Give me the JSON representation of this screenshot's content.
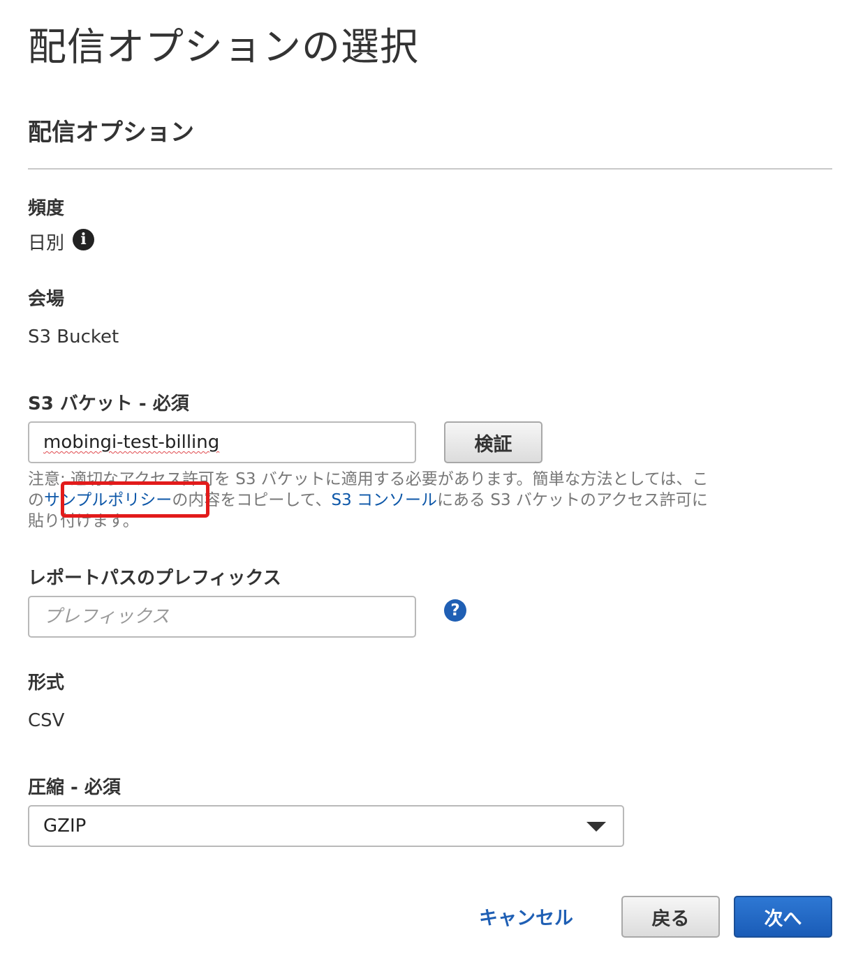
{
  "page": {
    "title": "配信オプションの選択",
    "section_title": "配信オプション"
  },
  "frequency": {
    "label": "頻度",
    "value": "日別",
    "info_icon_glyph": "i"
  },
  "destination": {
    "label": "会場",
    "value": "S3 Bucket"
  },
  "s3_bucket": {
    "label": "S3 バケット - 必須",
    "value": "mobingi-test-billing",
    "verify_button": "検証"
  },
  "note": {
    "prefix": "注意: 適切なアクセス許可を S3 バケットに適用する必要があります。簡単な方法としては、この",
    "sample_policy_link": "サンプルポリシー",
    "middle": "の内容をコピーして、",
    "console_link": "S3 コンソール",
    "suffix": "にある S3 バケットのアクセス許可に貼り付けます。",
    "highlight_color": "#e21b1b"
  },
  "report_prefix": {
    "label": "レポートパスのプレフィックス",
    "placeholder": "プレフィックス",
    "help_icon_glyph": "?"
  },
  "format": {
    "label": "形式",
    "value": "CSV"
  },
  "compression": {
    "label": "圧縮 - 必須",
    "selected": "GZIP"
  },
  "actions": {
    "cancel": "キャンセル",
    "back": "戻る",
    "next": "次へ",
    "primary_color": "#1a5cb7"
  }
}
